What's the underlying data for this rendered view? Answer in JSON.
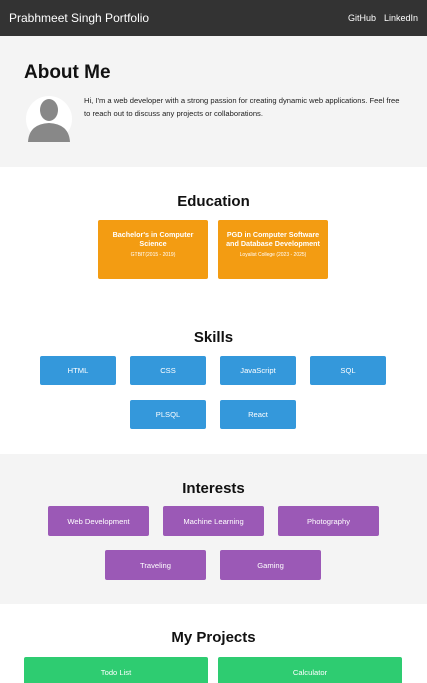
{
  "nav": {
    "title": "Prabhmeet Singh Portfolio",
    "links": [
      "GitHub",
      "LinkedIn"
    ]
  },
  "about": {
    "title": "About Me",
    "text": "Hi, I'm a web developer with a strong passion for creating dynamic web applications. Feel free to reach out to discuss any projects or collaborations."
  },
  "education": {
    "title": "Education",
    "items": [
      {
        "degree": "Bachelor's in Computer Science",
        "detail": "GTBIT(2015 - 2019)"
      },
      {
        "degree": "PGD in Computer Software and Database Development",
        "detail": "Loyalist College (2023 - 2025)"
      }
    ]
  },
  "skills": {
    "title": "Skills",
    "items": [
      "HTML",
      "CSS",
      "JavaScript",
      "SQL",
      "PLSQL",
      "React"
    ]
  },
  "interests": {
    "title": "Interests",
    "items": [
      "Web Development",
      "Machine Learning",
      "Photography",
      "Traveling",
      "Gaming"
    ]
  },
  "projects": {
    "title": "My Projects",
    "items": [
      "Todo List",
      "Calculator"
    ]
  },
  "colors": {
    "navbar": "#333333",
    "education": "#f39c12",
    "skills": "#3498db",
    "interests": "#9b59b6",
    "projects": "#2ecc71"
  },
  "icons": {
    "avatar": "user-avatar-icon"
  }
}
